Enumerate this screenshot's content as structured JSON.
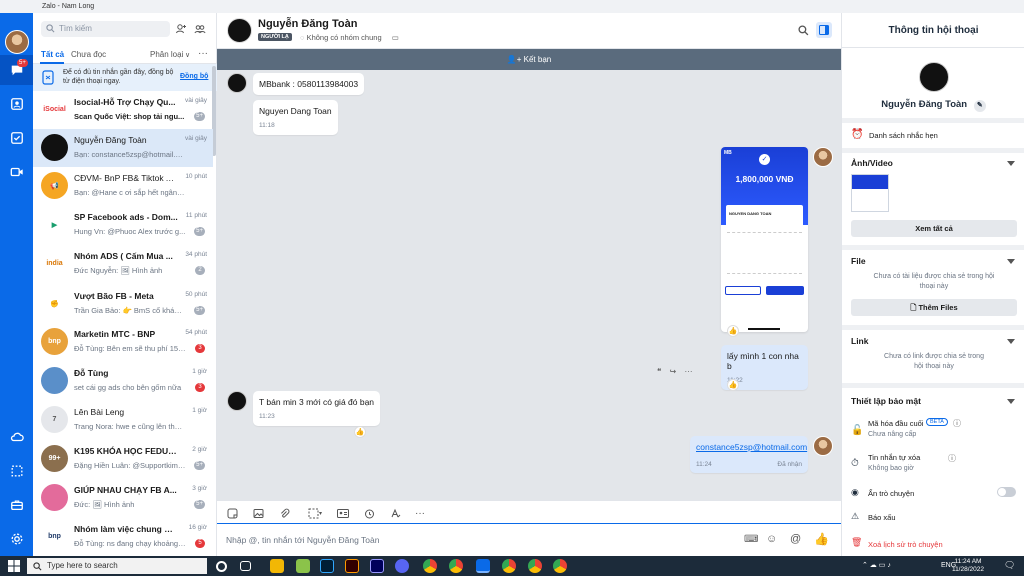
{
  "window": {
    "title": "Zalo - Nam Long"
  },
  "nav": {
    "badge": "5+"
  },
  "sidebar": {
    "search_placeholder": "Tìm kiếm",
    "tabs": {
      "all": "Tất cả",
      "unread": "Chưa đọc",
      "classify": "Phân loại"
    },
    "notice": {
      "text": "Để có đủ tin nhắn gần đây, đồng bộ từ điện thoại ngay.",
      "link": "Đồng bộ"
    },
    "conversations": [
      {
        "name": "Isocial-Hỗ Trợ Chạy Qu...",
        "preview": "Scan Quốc Việt: shop tải ngu...",
        "time": "vài giây",
        "badge": "5+",
        "badge_color": "grey",
        "avatar_text": "iSocial",
        "avatar_color": "#ffffff",
        "avatar_fg": "#e5383b"
      },
      {
        "name": "Nguyễn Đăng Toàn",
        "preview": "Bạn: constance5zsp@hotmail.com",
        "time": "vài giây",
        "badge": "",
        "badge_color": "",
        "avatar_text": "",
        "avatar_color": "#111111",
        "avatar_fg": "#ffffff"
      },
      {
        "name": "CĐVM- BnP FB& Tiktok Ads",
        "preview": "Bạn: @Hane c ơi sắp hết ngân sác...",
        "time": "10 phút",
        "badge": "",
        "badge_color": "",
        "avatar_text": "📢",
        "avatar_color": "#f5a623",
        "avatar_fg": "#ffffff"
      },
      {
        "name": "SP Facebook ads - Dom...",
        "preview": "Hung Vn: @Phuoc Alex trước g...",
        "time": "11 phút",
        "badge": "5+",
        "badge_color": "grey",
        "avatar_text": "▶",
        "avatar_color": "#ffffff",
        "avatar_fg": "#1a9e6e"
      },
      {
        "name": "Nhóm ADS ( Cấm Mua ...",
        "preview": "Đức Nguyễn: 🖼 Hình ảnh",
        "time": "34 phút",
        "badge": "2",
        "badge_color": "grey",
        "avatar_text": "india",
        "avatar_color": "#ffffff",
        "avatar_fg": "#d97706"
      },
      {
        "name": "Vượt Bão FB - Meta",
        "preview": "Trần Gia Bảo: 👉 BmS cổ kháng...",
        "time": "50 phút",
        "badge": "5+",
        "badge_color": "grey",
        "avatar_text": "✊",
        "avatar_color": "#ffffff",
        "avatar_fg": "#c0392b"
      },
      {
        "name": "Marketin MTC - BNP",
        "preview": "Đỗ Tùng: Bên em sẽ thu phí 15% ...",
        "time": "54 phút",
        "badge": "3",
        "badge_color": "red",
        "avatar_text": "bnp",
        "avatar_color": "#e8a23b",
        "avatar_fg": "#ffffff"
      },
      {
        "name": "Đỗ Tùng",
        "preview": "set cái gg ads cho bên gốm nữa",
        "time": "1 giờ",
        "badge": "3",
        "badge_color": "red",
        "avatar_text": "",
        "avatar_color": "#5a8fc9",
        "avatar_fg": "#ffffff"
      },
      {
        "name": "Lên Bài Leng",
        "preview": "Trang Nora: hwe e cũng lên thêm b...",
        "time": "1 giờ",
        "badge": "",
        "badge_color": "",
        "avatar_text": "7",
        "avatar_color": "#e5e7eb",
        "avatar_fg": "#555555"
      },
      {
        "name": "K195 KHÓA HỌC FEDU D...",
        "preview": "Đặng Hiền Luân: @Supportkime...",
        "time": "2 giờ",
        "badge": "5+",
        "badge_color": "grey",
        "avatar_text": "99+",
        "avatar_color": "#8b6f4e",
        "avatar_fg": "#ffffff"
      },
      {
        "name": "GIÚP NHAU CHẠY FB A...",
        "preview": "Đức: 🖼 Hình ảnh",
        "time": "3 giờ",
        "badge": "5+",
        "badge_color": "grey",
        "avatar_text": "",
        "avatar_color": "#e36b9b",
        "avatar_fg": "#ffffff"
      },
      {
        "name": "Nhóm làm việc chung BNP",
        "preview": "Đỗ Tùng: ns đang chạy khoảng 150...",
        "time": "16 giờ",
        "badge": "5",
        "badge_color": "red",
        "avatar_text": "bnp",
        "avatar_color": "#ffffff",
        "avatar_fg": "#1f3a68"
      }
    ]
  },
  "chat": {
    "name": "Nguyễn Đăng Toàn",
    "tag": "NGƯỜI LẠ",
    "group_status": "Không có nhóm chung",
    "friend_bar": "Kết bạn",
    "messages": {
      "m1": "MBbank : 0580113984003",
      "m2": "Nguyen Dang Toan",
      "m2_time": "11:18",
      "receipt_amount": "1,800,000 VNĐ",
      "receipt_name": "NGUYEN DANG TOAN",
      "m3": "lấy mình 1 con nha b",
      "m3_time": "11:22",
      "m4": "T bán min 3 mới có giá đó bạn",
      "m4_time": "11:23",
      "m5": "constance5zsp@hotmail.com",
      "m5_time": "11:24",
      "m5_status": "Đã nhận"
    },
    "input_placeholder": "Nhập @, tin nhắn tới Nguyễn Đăng Toàn"
  },
  "info": {
    "title": "Thông tin hội thoại",
    "name": "Nguyễn Đăng Toàn",
    "reminders": "Danh sách nhắc hẹn",
    "media": {
      "title": "Ảnh/Video",
      "button": "Xem tất cả"
    },
    "file": {
      "title": "File",
      "empty": "Chưa có tài liệu được chia sẻ trong hội thoại này",
      "button": "Thêm Files"
    },
    "link": {
      "title": "Link",
      "empty": "Chưa có link được chia sẻ trong hội thoại này"
    },
    "security": {
      "title": "Thiết lập bảo mật",
      "e2e": "Mã hóa đầu cuối",
      "e2e_badge": "BETA",
      "e2e_sub": "Chưa nâng cấp",
      "auto_delete": "Tin nhắn tự xóa",
      "auto_delete_sub": "Không bao giờ",
      "hide": "Ẩn trò chuyện",
      "report": "Báo xấu",
      "delete_history": "Xoá lịch sử trò chuyện"
    }
  },
  "taskbar": {
    "search": "Type here to search",
    "lang": "ENG",
    "time": "11:24 AM",
    "date": "11/28/2022"
  },
  "colors": {
    "accent": "#0a6ae8",
    "danger": "#e5383b"
  }
}
